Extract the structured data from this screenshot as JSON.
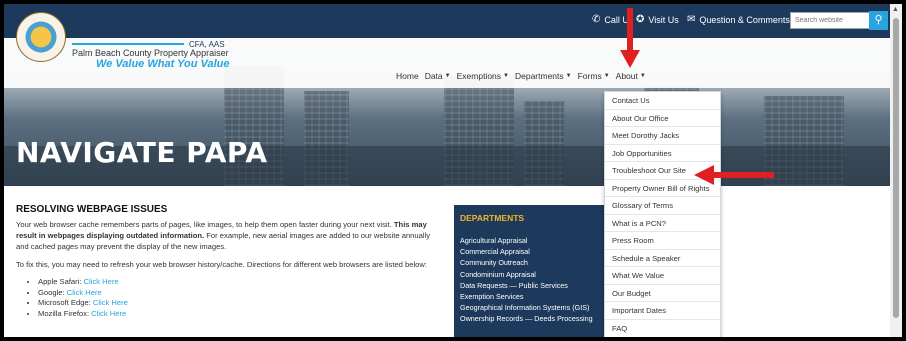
{
  "topbar": {
    "call_label": "Call Us",
    "visit_label": "Visit Us",
    "question_label": "Question & Comments",
    "search_placeholder": "Search website"
  },
  "logo": {
    "name_light": "DOROTHY",
    "name_bold": "JACKS",
    "credentials": "CFA, AAS",
    "subtitle": "Palm Beach County Property Appraiser",
    "tagline": "We Value What You Value"
  },
  "menu": [
    {
      "label": "Home",
      "caret": false
    },
    {
      "label": "Data",
      "caret": true
    },
    {
      "label": "Exemptions",
      "caret": true
    },
    {
      "label": "Departments",
      "caret": true
    },
    {
      "label": "Forms",
      "caret": true
    },
    {
      "label": "About",
      "caret": true
    }
  ],
  "page_title": "NAVIGATE PAPA",
  "content": {
    "heading": "RESOLVING WEBPAGE ISSUES",
    "p1_start": "Your web browser cache remembers parts of pages, like images, to help them open faster during your next visit. ",
    "p1_bold": "This may result in webpages displaying outdated information.",
    "p1_end": " For example, new aerial images are added to our website annually and cached pages may prevent the display of the new images.",
    "p2": "To fix this, you may need to refresh your web browser history/cache. Directions for different web browsers are listed below:",
    "browsers": [
      {
        "name": "Apple Safari: ",
        "link": "Click Here"
      },
      {
        "name": "Google: ",
        "link": "Click Here"
      },
      {
        "name": "Microsoft Edge: ",
        "link": "Click Here"
      },
      {
        "name": "Mozilla Firefox: ",
        "link": "Click Here"
      }
    ]
  },
  "departments": {
    "heading": "DEPARTMENTS",
    "items": [
      "Agricultural Appraisal",
      "Commercial Appraisal",
      "Community Outreach",
      "Condominium Appraisal",
      "Data Requests — Public Services",
      "Exemption Services",
      "Geographical Information Systems (GIS)",
      "Ownership Records — Deeds Processing"
    ]
  },
  "about_dropdown": [
    "Contact Us",
    "About Our Office",
    "Meet Dorothy Jacks",
    "Job Opportunities",
    "Troubleshoot Our Site",
    "Property Owner Bill of Rights",
    "Glossary of Terms",
    "What is a PCN?",
    "Press Room",
    "Schedule a Speaker",
    "What We Value",
    "Our Budget",
    "Important Dates",
    "FAQ"
  ],
  "colors": {
    "navy": "#1d3a5c",
    "accent_blue": "#29a4de",
    "dept_heading": "#f0b429",
    "annotation_red": "#e02020"
  },
  "icons": {
    "call": "phone-icon",
    "visit": "walking-person-icon",
    "question": "envelope-icon",
    "search": "search-icon"
  }
}
